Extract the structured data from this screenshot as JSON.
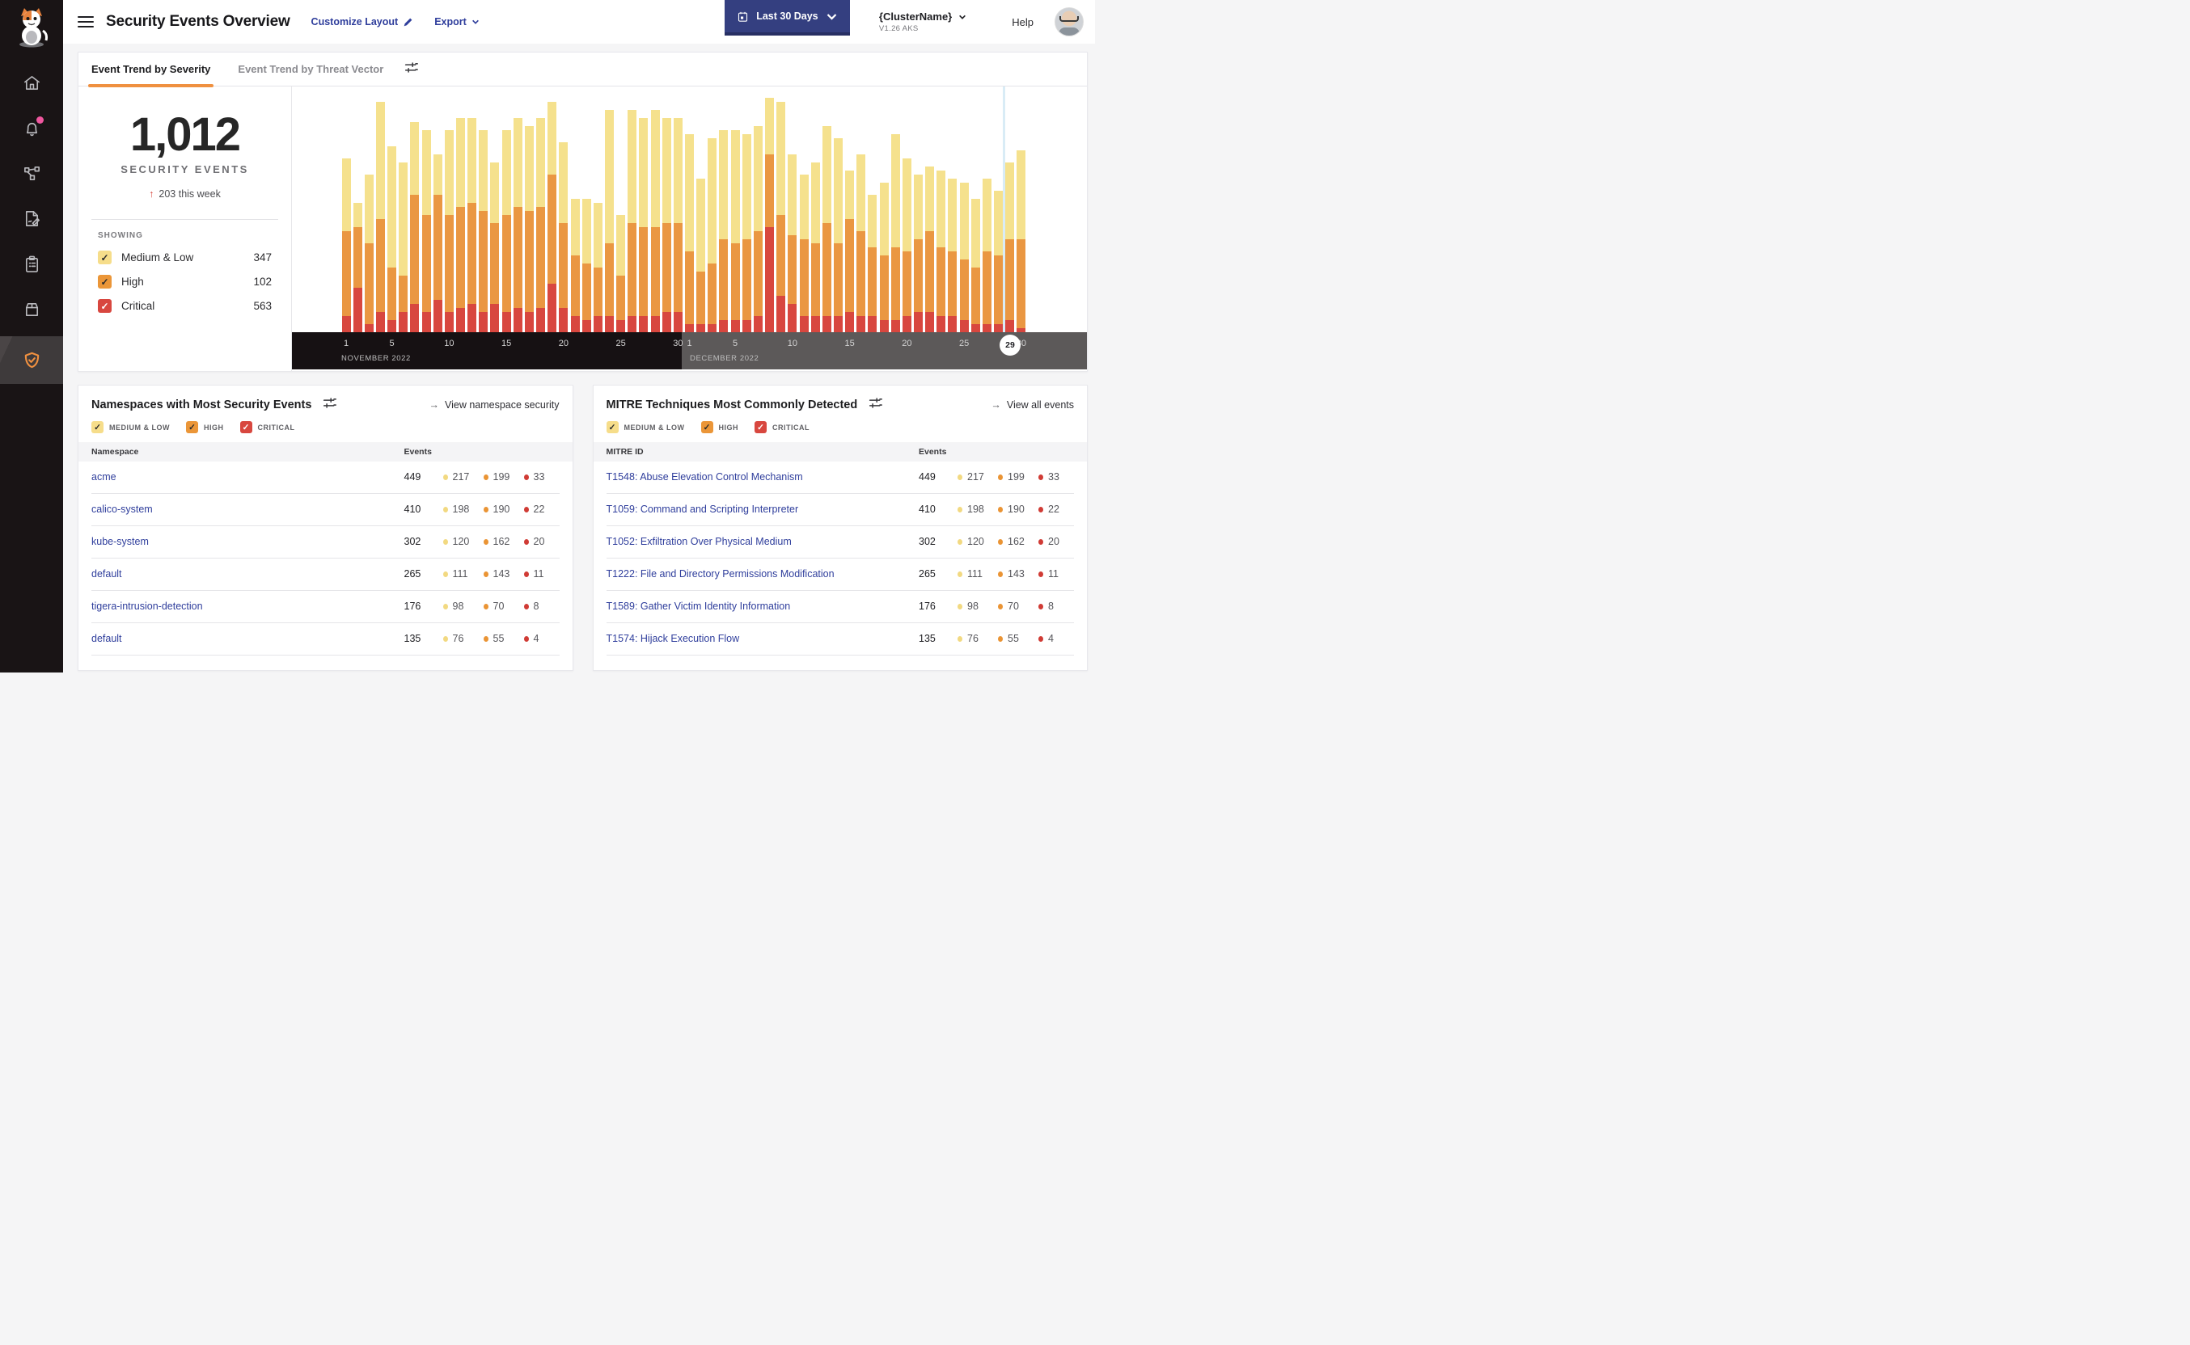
{
  "header": {
    "title": "Security Events Overview",
    "customize_label": "Customize Layout",
    "export_label": "Export",
    "date_button_label": "Last 30 Days",
    "cluster_name": "{ClusterName}",
    "cluster_version": "V1.26 AKS",
    "help_label": "Help"
  },
  "sidebar": {
    "icons": [
      "cat-logo",
      "home",
      "alerts",
      "service-graph",
      "policies",
      "compliance-reports",
      "workloads",
      "threat-defense"
    ],
    "active_item": "threat-defense",
    "alert_dot_color": "#f0579f"
  },
  "tabs": [
    {
      "label": "Event Trend by Severity",
      "active": true
    },
    {
      "label": "Event Trend by Threat Vector",
      "active": false
    }
  ],
  "summary": {
    "total": "1,012",
    "caption": "SECURITY EVENTS",
    "delta_arrow": "↑",
    "delta": "203 this week",
    "showing_label": "SHOWING",
    "legend": [
      {
        "label": "Medium & Low",
        "count": "347",
        "checked": true
      },
      {
        "label": "High",
        "count": "102",
        "checked": true
      },
      {
        "label": "Critical",
        "count": "563",
        "checked": true
      }
    ]
  },
  "severity_colors": {
    "medium_low": "#f5e18d",
    "high": "#ea9742",
    "critical": "#d8473f",
    "checkbox_medium": "#f6dd8a",
    "checkbox_high": "#eb9638",
    "checkbox_critical": "#d8473f",
    "dot_medium": "#f2d981",
    "dot_high": "#ea9434",
    "dot_critical": "#d03b35"
  },
  "chart_data": {
    "type": "bar",
    "stacked": true,
    "title": "Event Trend by Severity",
    "categories": [
      "Nov 1",
      "Nov 2",
      "Nov 3",
      "Nov 4",
      "Nov 5",
      "Nov 6",
      "Nov 7",
      "Nov 8",
      "Nov 9",
      "Nov 10",
      "Nov 11",
      "Nov 12",
      "Nov 13",
      "Nov 14",
      "Nov 15",
      "Nov 16",
      "Nov 17",
      "Nov 18",
      "Nov 19",
      "Nov 20",
      "Nov 21",
      "Nov 22",
      "Nov 23",
      "Nov 24",
      "Nov 25",
      "Nov 26",
      "Nov 27",
      "Nov 28",
      "Nov 29",
      "Nov 30",
      "Dec 1",
      "Dec 2",
      "Dec 3",
      "Dec 4",
      "Dec 5",
      "Dec 6",
      "Dec 7",
      "Dec 8",
      "Dec 9",
      "Dec 10",
      "Dec 11",
      "Dec 12",
      "Dec 13",
      "Dec 14",
      "Dec 15",
      "Dec 16",
      "Dec 17",
      "Dec 18",
      "Dec 19",
      "Dec 20",
      "Dec 21",
      "Dec 22",
      "Dec 23",
      "Dec 24",
      "Dec 25",
      "Dec 26",
      "Dec 27",
      "Dec 28",
      "Dec 29",
      "Dec 30"
    ],
    "series": [
      {
        "name": "Critical",
        "values": [
          4,
          11,
          2,
          5,
          3,
          5,
          7,
          5,
          8,
          5,
          6,
          7,
          5,
          7,
          5,
          6,
          5,
          6,
          12,
          6,
          4,
          3,
          4,
          4,
          3,
          4,
          4,
          4,
          5,
          5,
          2,
          2,
          2,
          3,
          3,
          3,
          4,
          26,
          9,
          7,
          4,
          4,
          4,
          4,
          5,
          4,
          4,
          3,
          3,
          4,
          5,
          5,
          4,
          4,
          3,
          2,
          2,
          2,
          3,
          1
        ]
      },
      {
        "name": "High",
        "values": [
          21,
          15,
          20,
          23,
          13,
          9,
          27,
          24,
          26,
          24,
          25,
          25,
          25,
          20,
          24,
          25,
          25,
          25,
          27,
          21,
          15,
          14,
          12,
          18,
          11,
          23,
          22,
          22,
          22,
          22,
          18,
          13,
          15,
          20,
          19,
          20,
          21,
          18,
          20,
          17,
          19,
          18,
          23,
          18,
          23,
          21,
          17,
          16,
          18,
          16,
          18,
          20,
          17,
          16,
          15,
          14,
          18,
          17,
          20,
          22
        ]
      },
      {
        "name": "Medium & Low",
        "values": [
          18,
          6,
          17,
          29,
          30,
          28,
          18,
          21,
          10,
          21,
          22,
          21,
          20,
          15,
          21,
          22,
          21,
          22,
          18,
          20,
          14,
          16,
          16,
          33,
          15,
          28,
          27,
          29,
          26,
          26,
          29,
          23,
          31,
          27,
          28,
          26,
          26,
          14,
          28,
          20,
          16,
          20,
          24,
          26,
          12,
          19,
          13,
          18,
          28,
          23,
          16,
          16,
          19,
          18,
          19,
          17,
          18,
          16,
          19,
          22
        ]
      }
    ],
    "legend_position": "left",
    "grid": false,
    "axis": {
      "november": {
        "label": "NOVEMBER 2022",
        "ticks": [
          1,
          5,
          10,
          15,
          20,
          25,
          30
        ]
      },
      "december": {
        "label": "DECEMBER 2022",
        "ticks": [
          1,
          5,
          10,
          15,
          20,
          25,
          30
        ]
      }
    },
    "selected_day_label": "29"
  },
  "namespaces_panel": {
    "title": "Namespaces with Most Security Events",
    "link": "View namespace security",
    "link_arrow": "→",
    "filters": [
      {
        "label": "MEDIUM & LOW",
        "checked": true
      },
      {
        "label": "HIGH",
        "checked": true
      },
      {
        "label": "CRITICAL",
        "checked": true
      }
    ],
    "columns": [
      "Namespace",
      "Events"
    ],
    "rows": [
      {
        "name": "acme",
        "total": "449",
        "medium": "217",
        "high": "199",
        "critical": "33"
      },
      {
        "name": "calico-system",
        "total": "410",
        "medium": "198",
        "high": "190",
        "critical": "22"
      },
      {
        "name": "kube-system",
        "total": "302",
        "medium": "120",
        "high": "162",
        "critical": "20"
      },
      {
        "name": "default",
        "total": "265",
        "medium": "111",
        "high": "143",
        "critical": "11"
      },
      {
        "name": "tigera-intrusion-detection",
        "total": "176",
        "medium": "98",
        "high": "70",
        "critical": "8"
      },
      {
        "name": "default",
        "total": "135",
        "medium": "76",
        "high": "55",
        "critical": "4"
      }
    ]
  },
  "mitre_panel": {
    "title": "MITRE Techniques Most Commonly Detected",
    "link": "View all events",
    "link_arrow": "→",
    "filters": [
      {
        "label": "MEDIUM & LOW",
        "checked": true
      },
      {
        "label": "HIGH",
        "checked": true
      },
      {
        "label": "CRITICAL",
        "checked": true
      }
    ],
    "columns": [
      "MITRE ID",
      "Events"
    ],
    "rows": [
      {
        "name": "T1548: Abuse Elevation Control Mechanism",
        "total": "449",
        "medium": "217",
        "high": "199",
        "critical": "33"
      },
      {
        "name": "T1059: Command and Scripting Interpreter",
        "total": "410",
        "medium": "198",
        "high": "190",
        "critical": "22"
      },
      {
        "name": "T1052: Exfiltration Over Physical Medium",
        "total": "302",
        "medium": "120",
        "high": "162",
        "critical": "20"
      },
      {
        "name": "T1222: File and Directory Permissions Modification",
        "total": "265",
        "medium": "111",
        "high": "143",
        "critical": "11"
      },
      {
        "name": "T1589: Gather Victim Identity Information",
        "total": "176",
        "medium": "98",
        "high": "70",
        "critical": "8"
      },
      {
        "name": "T1574: Hijack Execution Flow",
        "total": "135",
        "medium": "76",
        "high": "55",
        "critical": "4"
      }
    ]
  }
}
